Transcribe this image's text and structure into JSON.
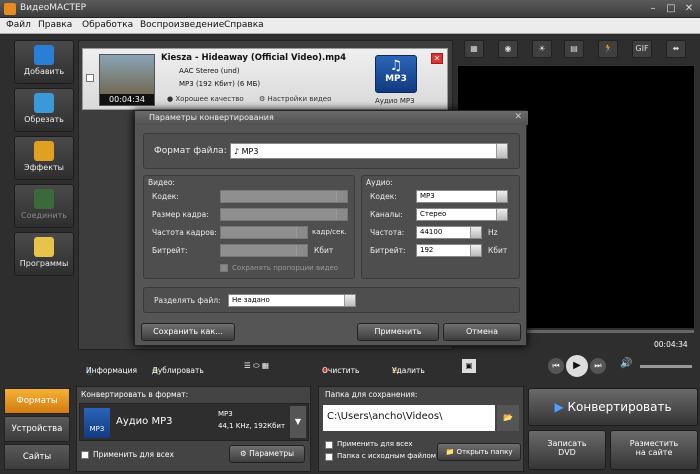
{
  "window": {
    "title": "ВидеоМАСТЕР"
  },
  "menu": [
    "Файл",
    "Правка",
    "Обработка",
    "Воспроизведение",
    "Справка"
  ],
  "sidebar": [
    {
      "label": "Добавить",
      "color": "#2a7fd4"
    },
    {
      "label": "Обрезать",
      "color": "#3a9ad9"
    },
    {
      "label": "Эффекты",
      "color": "#e0a020"
    },
    {
      "label": "Соединить",
      "color": "#3ea33e",
      "disabled": true
    },
    {
      "label": "Программы",
      "color": "#e6c34a"
    }
  ],
  "file": {
    "name": "Kiesza - Hideaway (Official Video).mp4",
    "audio": "AAC Stereo (und)",
    "out": "MP3 (192 Кбит) (6 МБ)",
    "quality": "Хорошее качество",
    "video_settings": "Настройки видео",
    "time": "00:04:34",
    "badge_top": "MP3",
    "badge_label": "Аудио MP3"
  },
  "dialog": {
    "title": "Параметры конвертирования",
    "format_label": "Формат файла:",
    "format_value": "MP3",
    "video_section": "Видео:",
    "audio_section": "Аудио:",
    "video_labels": [
      "Кодек:",
      "Размер кадра:",
      "Частота кадров:",
      "Битрейт:"
    ],
    "fps_unit": "кадр/сек.",
    "kbit_unit": "Кбит",
    "keep_ratio": "Сохранять пропорции видео",
    "audio_labels": [
      "Кодек:",
      "Каналы:",
      "Частота:",
      "Битрейт:"
    ],
    "audio_values": [
      "MP3",
      "Стерео",
      "44100",
      "192"
    ],
    "hz_unit": "Hz",
    "split_label": "Разделять файл:",
    "split_value": "Не задано",
    "save_as": "Сохранить как...",
    "apply": "Применить",
    "cancel": "Отмена"
  },
  "bottombar": {
    "info": "Информация",
    "dup": "Дублировать",
    "clear": "Очистить",
    "del": "Удалить"
  },
  "player": {
    "time": "00:04:34"
  },
  "tabs": {
    "formats": "Форматы",
    "devices": "Устройства",
    "sites": "Сайты"
  },
  "convert": {
    "label": "Конвертировать в формат:",
    "format": "Аудио MP3",
    "badge": "MP3",
    "spec1": "MP3",
    "spec2": "44,1 KHz, 192Кбит",
    "apply_all": "Применить для всех",
    "params": "Параметры"
  },
  "save": {
    "label": "Папка для сохранения:",
    "path": "C:\\Users\\ancho\\Videos\\",
    "apply_all": "Применить для всех",
    "src_folder": "Папка с исходным файлом",
    "open_folder": "Открыть папку"
  },
  "actions": {
    "convert": "Конвертировать",
    "dvd1": "Записать",
    "dvd2": "DVD",
    "web1": "Разместить",
    "web2": "на сайте"
  },
  "vtools": [
    "▦",
    "◉",
    "☀",
    "▤",
    "🏃",
    "GIF",
    "⬌"
  ]
}
